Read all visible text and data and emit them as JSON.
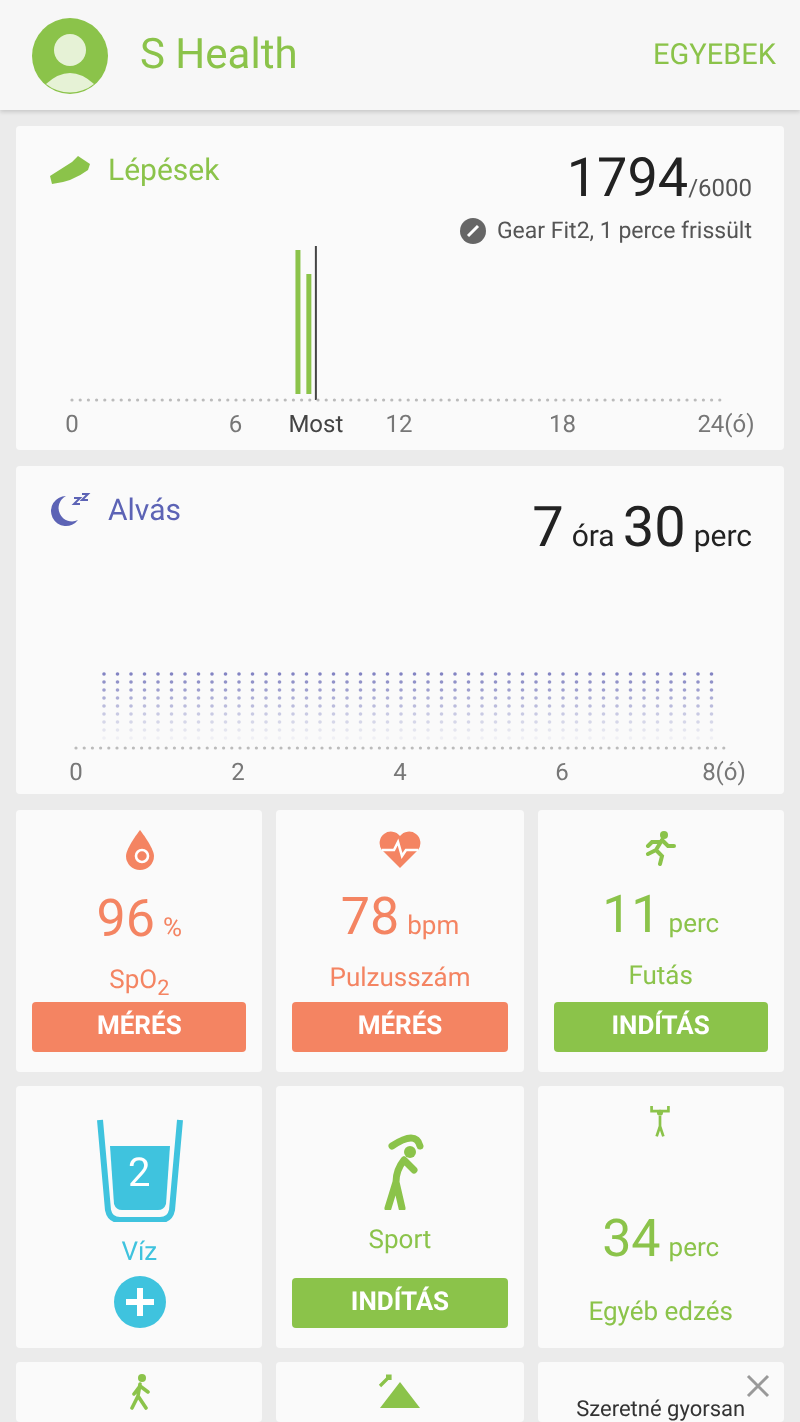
{
  "header": {
    "title": "S Health",
    "more_button": "EGYEBEK"
  },
  "steps": {
    "title": "Lépések",
    "count": "1794",
    "goal": "/6000",
    "device_status": "Gear Fit2, 1 perce frissült",
    "axis_labels": [
      "0",
      "6",
      "Most",
      "12",
      "18",
      "24(ó)"
    ]
  },
  "sleep": {
    "title": "Alvás",
    "hours": "7",
    "hours_unit": "óra",
    "minutes": "30",
    "minutes_unit": "perc",
    "axis_labels": [
      "0",
      "2",
      "4",
      "6",
      "8(ó)"
    ]
  },
  "tiles": [
    {
      "kind": "spo2",
      "value": "96",
      "unit": "%",
      "label": "SpO$_{2}$",
      "button": "MÉRÉS",
      "color": "#f48462"
    },
    {
      "kind": "heart_rate",
      "value": "78",
      "unit": "bpm",
      "label": "Pulzusszám",
      "button": "MÉRÉS",
      "color": "#f48462"
    },
    {
      "kind": "running",
      "value": "11",
      "unit": "perc",
      "label": "Futás",
      "button": "INDÍTÁS",
      "color": "#8bc34a"
    },
    {
      "kind": "water",
      "value": "2",
      "label": "Víz",
      "color": "#3fc3de"
    },
    {
      "kind": "sport",
      "label": "Sport",
      "button": "INDÍTÁS",
      "color": "#8bc34a"
    },
    {
      "kind": "workout",
      "value": "34",
      "unit": "perc",
      "label": "Egyéb edzés",
      "color": "#8bc34a"
    },
    {
      "kind": "walking",
      "color": "#8bc34a"
    },
    {
      "kind": "hiking",
      "color": "#8bc34a"
    },
    {
      "kind": "promo",
      "text": "Szeretné gyorsan"
    }
  ]
}
